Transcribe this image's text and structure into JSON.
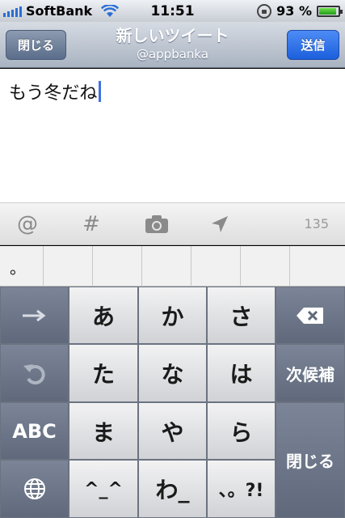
{
  "status": {
    "carrier": "SoftBank",
    "time": "11:51",
    "battery_percent": "93 %",
    "battery_level": 0.93,
    "signal_bars": 5
  },
  "nav": {
    "close_label": "閉じる",
    "title": "新しいツイート",
    "account": "@appbanka",
    "send_label": "送信"
  },
  "compose": {
    "text": "もう冬だね"
  },
  "toolbar": {
    "mention_icon": "@",
    "hashtag_icon": "#",
    "char_count": "135"
  },
  "candidates": [
    "。",
    "",
    "",
    "",
    "",
    "",
    ""
  ],
  "keyboard": {
    "rows": [
      [
        "あ",
        "か",
        "さ"
      ],
      [
        "た",
        "な",
        "は"
      ],
      [
        "ま",
        "や",
        "ら"
      ],
      [
        "^_^",
        "わ_",
        "、。?!"
      ]
    ],
    "abc_label": "ABC",
    "next_candidate_label": "次候補",
    "close_label": "閉じる"
  }
}
